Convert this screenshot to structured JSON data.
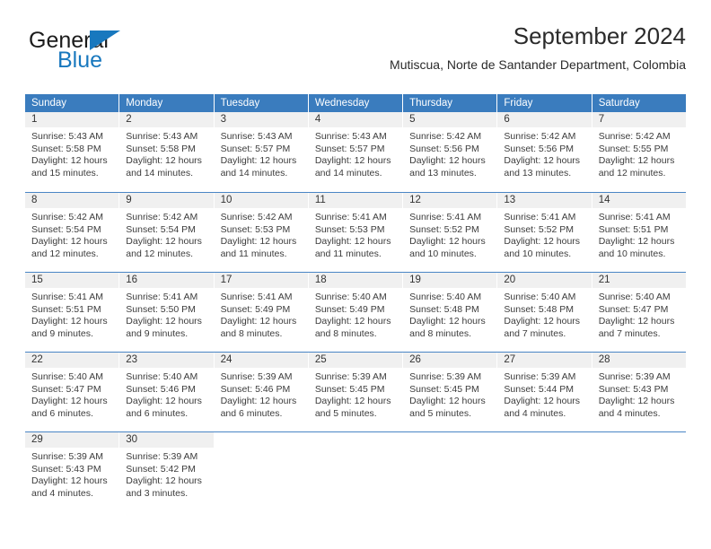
{
  "brand": {
    "name_part1": "General",
    "name_part2": "Blue",
    "accent_color": "#1878be"
  },
  "header": {
    "title": "September 2024",
    "subtitle": "Mutiscua, Norte de Santander Department, Colombia"
  },
  "calendar": {
    "header_color": "#3a7cbe",
    "daynum_bg": "#f0f0f0",
    "weekdays": [
      "Sunday",
      "Monday",
      "Tuesday",
      "Wednesday",
      "Thursday",
      "Friday",
      "Saturday"
    ],
    "weeks": [
      [
        {
          "day": "1",
          "lines": [
            "Sunrise: 5:43 AM",
            "Sunset: 5:58 PM",
            "Daylight: 12 hours",
            "and 15 minutes."
          ]
        },
        {
          "day": "2",
          "lines": [
            "Sunrise: 5:43 AM",
            "Sunset: 5:58 PM",
            "Daylight: 12 hours",
            "and 14 minutes."
          ]
        },
        {
          "day": "3",
          "lines": [
            "Sunrise: 5:43 AM",
            "Sunset: 5:57 PM",
            "Daylight: 12 hours",
            "and 14 minutes."
          ]
        },
        {
          "day": "4",
          "lines": [
            "Sunrise: 5:43 AM",
            "Sunset: 5:57 PM",
            "Daylight: 12 hours",
            "and 14 minutes."
          ]
        },
        {
          "day": "5",
          "lines": [
            "Sunrise: 5:42 AM",
            "Sunset: 5:56 PM",
            "Daylight: 12 hours",
            "and 13 minutes."
          ]
        },
        {
          "day": "6",
          "lines": [
            "Sunrise: 5:42 AM",
            "Sunset: 5:56 PM",
            "Daylight: 12 hours",
            "and 13 minutes."
          ]
        },
        {
          "day": "7",
          "lines": [
            "Sunrise: 5:42 AM",
            "Sunset: 5:55 PM",
            "Daylight: 12 hours",
            "and 12 minutes."
          ]
        }
      ],
      [
        {
          "day": "8",
          "lines": [
            "Sunrise: 5:42 AM",
            "Sunset: 5:54 PM",
            "Daylight: 12 hours",
            "and 12 minutes."
          ]
        },
        {
          "day": "9",
          "lines": [
            "Sunrise: 5:42 AM",
            "Sunset: 5:54 PM",
            "Daylight: 12 hours",
            "and 12 minutes."
          ]
        },
        {
          "day": "10",
          "lines": [
            "Sunrise: 5:42 AM",
            "Sunset: 5:53 PM",
            "Daylight: 12 hours",
            "and 11 minutes."
          ]
        },
        {
          "day": "11",
          "lines": [
            "Sunrise: 5:41 AM",
            "Sunset: 5:53 PM",
            "Daylight: 12 hours",
            "and 11 minutes."
          ]
        },
        {
          "day": "12",
          "lines": [
            "Sunrise: 5:41 AM",
            "Sunset: 5:52 PM",
            "Daylight: 12 hours",
            "and 10 minutes."
          ]
        },
        {
          "day": "13",
          "lines": [
            "Sunrise: 5:41 AM",
            "Sunset: 5:52 PM",
            "Daylight: 12 hours",
            "and 10 minutes."
          ]
        },
        {
          "day": "14",
          "lines": [
            "Sunrise: 5:41 AM",
            "Sunset: 5:51 PM",
            "Daylight: 12 hours",
            "and 10 minutes."
          ]
        }
      ],
      [
        {
          "day": "15",
          "lines": [
            "Sunrise: 5:41 AM",
            "Sunset: 5:51 PM",
            "Daylight: 12 hours",
            "and 9 minutes."
          ]
        },
        {
          "day": "16",
          "lines": [
            "Sunrise: 5:41 AM",
            "Sunset: 5:50 PM",
            "Daylight: 12 hours",
            "and 9 minutes."
          ]
        },
        {
          "day": "17",
          "lines": [
            "Sunrise: 5:41 AM",
            "Sunset: 5:49 PM",
            "Daylight: 12 hours",
            "and 8 minutes."
          ]
        },
        {
          "day": "18",
          "lines": [
            "Sunrise: 5:40 AM",
            "Sunset: 5:49 PM",
            "Daylight: 12 hours",
            "and 8 minutes."
          ]
        },
        {
          "day": "19",
          "lines": [
            "Sunrise: 5:40 AM",
            "Sunset: 5:48 PM",
            "Daylight: 12 hours",
            "and 8 minutes."
          ]
        },
        {
          "day": "20",
          "lines": [
            "Sunrise: 5:40 AM",
            "Sunset: 5:48 PM",
            "Daylight: 12 hours",
            "and 7 minutes."
          ]
        },
        {
          "day": "21",
          "lines": [
            "Sunrise: 5:40 AM",
            "Sunset: 5:47 PM",
            "Daylight: 12 hours",
            "and 7 minutes."
          ]
        }
      ],
      [
        {
          "day": "22",
          "lines": [
            "Sunrise: 5:40 AM",
            "Sunset: 5:47 PM",
            "Daylight: 12 hours",
            "and 6 minutes."
          ]
        },
        {
          "day": "23",
          "lines": [
            "Sunrise: 5:40 AM",
            "Sunset: 5:46 PM",
            "Daylight: 12 hours",
            "and 6 minutes."
          ]
        },
        {
          "day": "24",
          "lines": [
            "Sunrise: 5:39 AM",
            "Sunset: 5:46 PM",
            "Daylight: 12 hours",
            "and 6 minutes."
          ]
        },
        {
          "day": "25",
          "lines": [
            "Sunrise: 5:39 AM",
            "Sunset: 5:45 PM",
            "Daylight: 12 hours",
            "and 5 minutes."
          ]
        },
        {
          "day": "26",
          "lines": [
            "Sunrise: 5:39 AM",
            "Sunset: 5:45 PM",
            "Daylight: 12 hours",
            "and 5 minutes."
          ]
        },
        {
          "day": "27",
          "lines": [
            "Sunrise: 5:39 AM",
            "Sunset: 5:44 PM",
            "Daylight: 12 hours",
            "and 4 minutes."
          ]
        },
        {
          "day": "28",
          "lines": [
            "Sunrise: 5:39 AM",
            "Sunset: 5:43 PM",
            "Daylight: 12 hours",
            "and 4 minutes."
          ]
        }
      ],
      [
        {
          "day": "29",
          "lines": [
            "Sunrise: 5:39 AM",
            "Sunset: 5:43 PM",
            "Daylight: 12 hours",
            "and 4 minutes."
          ]
        },
        {
          "day": "30",
          "lines": [
            "Sunrise: 5:39 AM",
            "Sunset: 5:42 PM",
            "Daylight: 12 hours",
            "and 3 minutes."
          ]
        },
        {
          "day": "",
          "lines": []
        },
        {
          "day": "",
          "lines": []
        },
        {
          "day": "",
          "lines": []
        },
        {
          "day": "",
          "lines": []
        },
        {
          "day": "",
          "lines": []
        }
      ]
    ]
  }
}
